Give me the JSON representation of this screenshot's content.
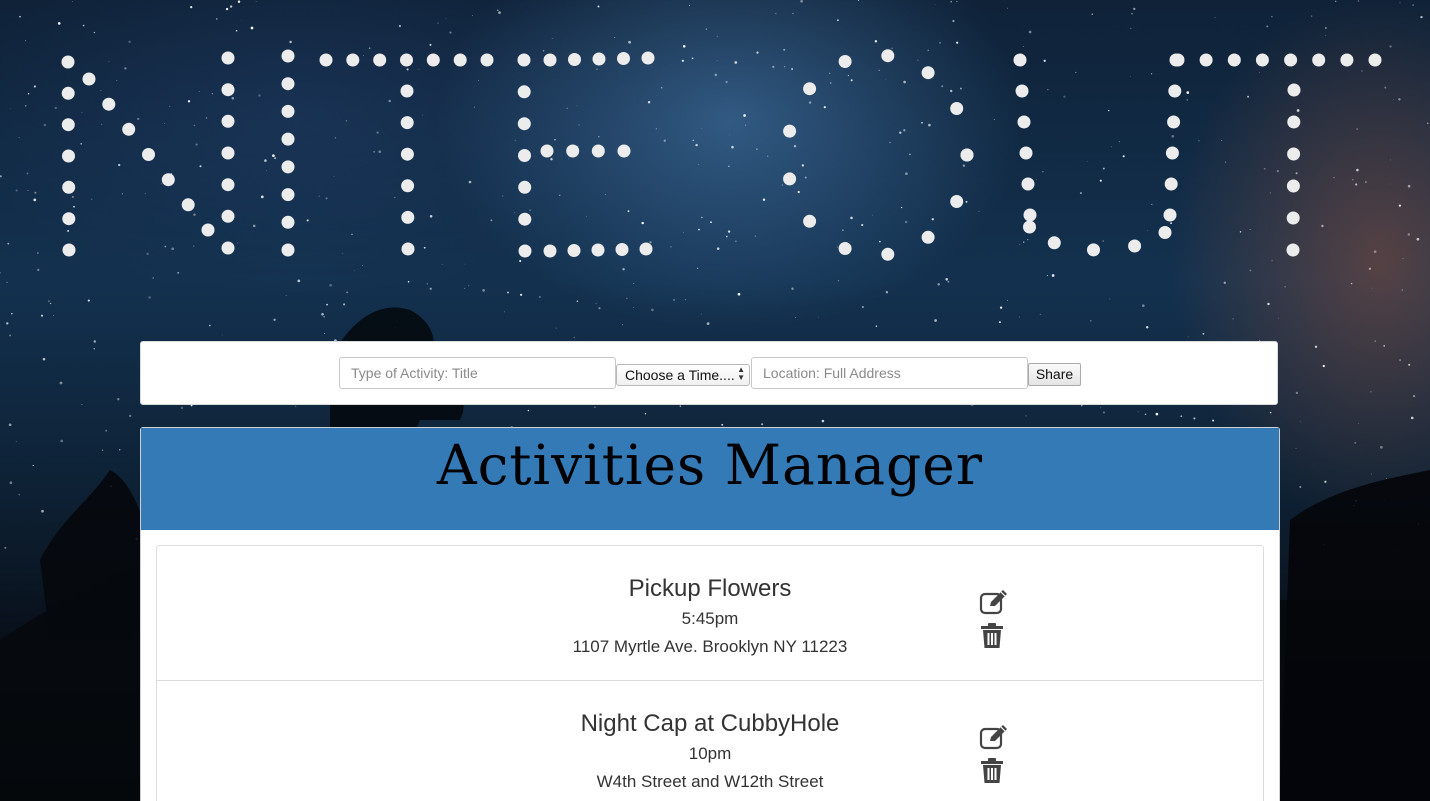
{
  "app": {
    "logo_text": "NITE OUT"
  },
  "form": {
    "title_placeholder": "Type of Activity: Title",
    "time_select_value": "Choose a Time....",
    "location_placeholder": "Location: Full Address",
    "share_label": "Share"
  },
  "manager": {
    "title": "Activities Manager",
    "header_color": "#337ab7"
  },
  "activities": [
    {
      "title": "Pickup Flowers",
      "time": "5:45pm",
      "location": "1107 Myrtle Ave. Brooklyn NY 11223"
    },
    {
      "title": "Night Cap at CubbyHole",
      "time": "10pm",
      "location": "W4th Street and W12th Street"
    }
  ],
  "icons": {
    "edit": "edit-icon",
    "delete": "trash-icon"
  }
}
